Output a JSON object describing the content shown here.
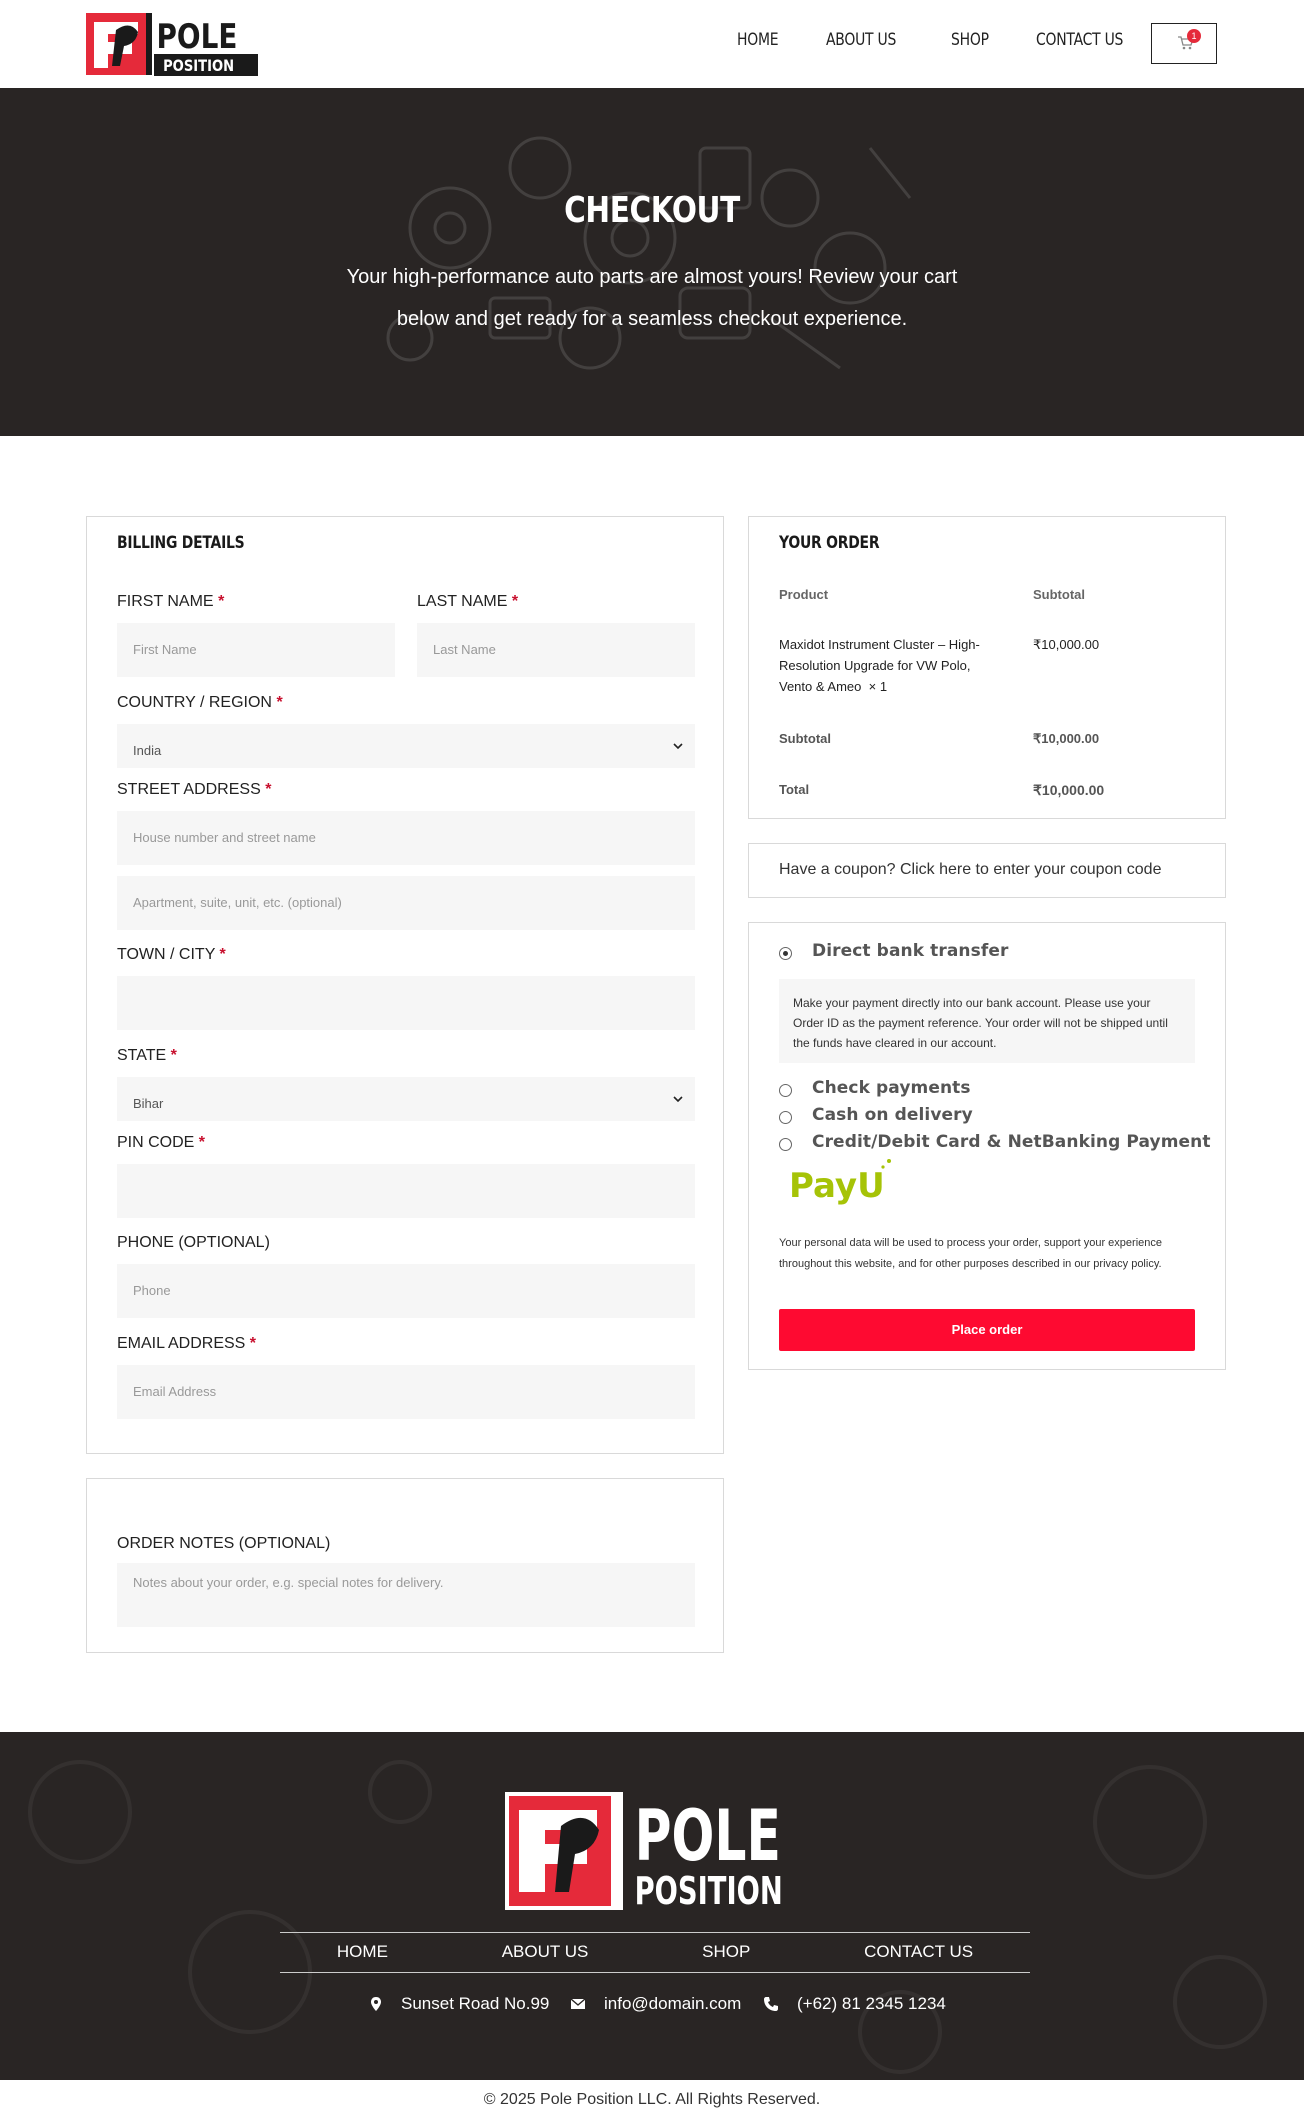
{
  "header": {
    "brand": "POLE POSITION",
    "logo_text_top": "POLE",
    "logo_text_bottom": "POSITION",
    "nav": [
      "HOME",
      "ABOUT US",
      "SHOP",
      "CONTACT US"
    ],
    "cart_count": "1"
  },
  "hero": {
    "title": "CHECKOUT",
    "subtitle": "Your high-performance auto parts are almost yours! Review your cart below and get ready for a seamless checkout experience."
  },
  "billing": {
    "title": "BILLING DETAILS",
    "first_name_label": "FIRST NAME",
    "first_name_placeholder": "First Name",
    "last_name_label": "LAST NAME",
    "last_name_placeholder": "Last Name",
    "country_label": "COUNTRY / REGION",
    "country_value": "India",
    "street_label": "STREET ADDRESS",
    "street_placeholder": "House number and street name",
    "apartment_placeholder": "Apartment, suite, unit, etc. (optional)",
    "city_label": "TOWN / CITY",
    "state_label": "STATE",
    "state_value": "Bihar",
    "pin_label": "PIN CODE",
    "phone_label": "PHONE (OPTIONAL)",
    "phone_placeholder": "Phone",
    "email_label": "EMAIL ADDRESS",
    "email_placeholder": "Email Address",
    "required_mark": "*"
  },
  "notes": {
    "label": "ORDER NOTES (OPTIONAL)",
    "placeholder": "Notes about your order, e.g. special notes for delivery."
  },
  "order": {
    "title": "YOUR ORDER",
    "col_product": "Product",
    "col_subtotal": "Subtotal",
    "item_name": "Maxidot Instrument Cluster – High-Resolution Upgrade for VW Polo, Vento & Ameo",
    "item_qty": "× 1",
    "item_price": "₹10,000.00",
    "subtotal_label": "Subtotal",
    "subtotal_value": "₹10,000.00",
    "total_label": "Total",
    "total_value": "₹10,000.00"
  },
  "coupon": {
    "text": "Have a coupon? Click here to enter your coupon code"
  },
  "payment": {
    "methods": [
      "Direct bank transfer",
      "Check payments",
      "Cash on delivery",
      "Credit/Debit Card & NetBanking Payment"
    ],
    "selected": "Direct bank transfer",
    "bank_desc": "Make your payment directly into our bank account. Please use your Order ID as the payment reference. Your order will not be shipped until the funds have cleared in our account.",
    "payu_logo": "PayU",
    "privacy": "Your personal data will be used to process your order, support your experience throughout this website, and for other purposes described in our privacy policy.",
    "place_order": "Place order"
  },
  "footer": {
    "nav": [
      "HOME",
      "ABOUT US",
      "SHOP",
      "CONTACT US"
    ],
    "address": "Sunset Road No.99",
    "email": "info@domain.com",
    "phone": "(+62) 81 2345 1234",
    "copyright": "© 2025 Pole Position LLC. All Rights Reserved."
  },
  "colors": {
    "accent": "#fe0a31",
    "dark_bg": "#292524",
    "logo_red": "#e52a3a"
  }
}
